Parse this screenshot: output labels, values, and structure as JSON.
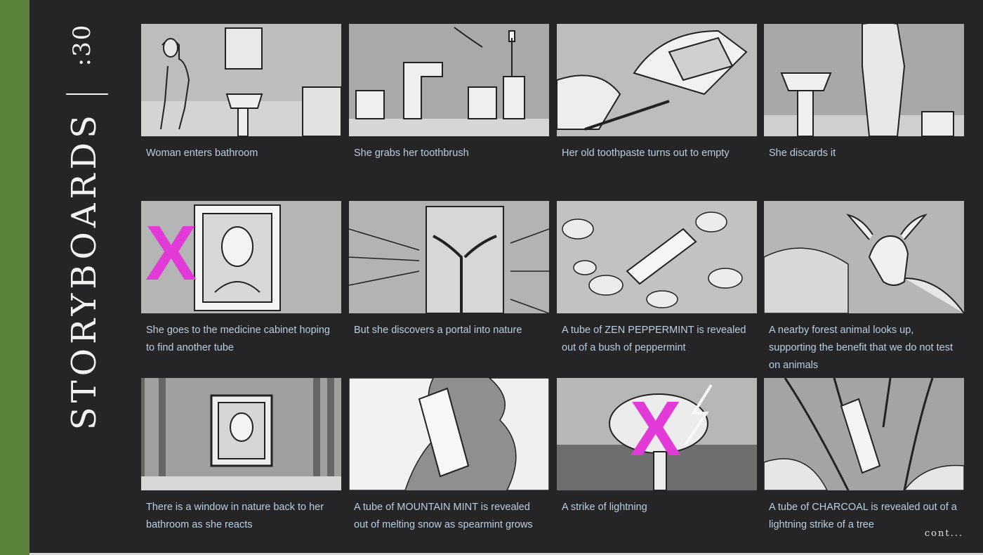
{
  "sidebar": {
    "duration": ":30",
    "title": "STORYBOARDS",
    "accent_color": "#5a823a"
  },
  "frames": [
    {
      "caption": "Woman enters bathroom",
      "scene": "woman-bathroom",
      "x_mark": false
    },
    {
      "caption": "She grabs her toothbrush",
      "scene": "faucet-toothbrush",
      "x_mark": false
    },
    {
      "caption": "Her old toothpaste turns out to empty",
      "scene": "squeeze-tube",
      "x_mark": false
    },
    {
      "caption": "She discards it",
      "scene": "discard",
      "x_mark": false
    },
    {
      "caption": "She goes to the medicine cabinet hoping to find another tube",
      "scene": "mirror-face",
      "x_mark": true,
      "x_label": "X"
    },
    {
      "caption": "But she discovers a portal into nature",
      "scene": "portal-tree",
      "x_mark": false
    },
    {
      "caption": "A tube of ZEN PEPPERMINT is revealed out of a bush of peppermint",
      "scene": "tube-bush",
      "x_mark": false
    },
    {
      "caption": "A nearby forest animal looks up, supporting the benefit that we do not test on animals",
      "scene": "deer",
      "x_mark": false
    },
    {
      "caption": "There is a window in nature back to her bathroom as she reacts",
      "scene": "forest-window",
      "x_mark": false
    },
    {
      "caption": "A tube of MOUNTAIN MINT is revealed out of melting snow as spearmint grows",
      "scene": "tube-snow",
      "x_mark": false
    },
    {
      "caption": "A strike of lightning",
      "scene": "lightning",
      "x_mark": true,
      "x_label": "X"
    },
    {
      "caption": "A tube of CHARCOAL is revealed out of a lightning strike of a tree",
      "scene": "tube-charcoal",
      "x_mark": false
    }
  ],
  "footer": {
    "cont_label": "cont..."
  },
  "colors": {
    "background": "#252427",
    "caption": "#b9cfe0",
    "x_mark": "#e23ad6"
  }
}
